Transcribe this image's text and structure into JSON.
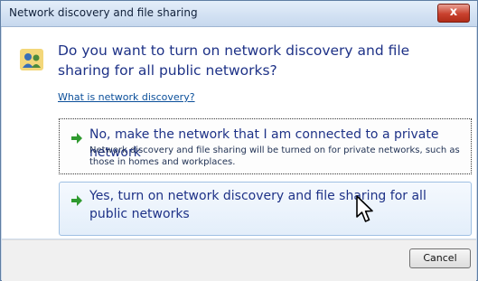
{
  "window": {
    "title": "Network discovery and file sharing",
    "close_label": "x"
  },
  "question": "Do you want to turn on network discovery and file sharing for all public networks?",
  "help_link": "What is network discovery?",
  "options": [
    {
      "title": "No, make the network that I am connected to a private network",
      "description": "Network discovery and file sharing will be turned on for private networks, such as those in homes and workplaces."
    },
    {
      "title": "Yes, turn on network discovery and file sharing for all public networks"
    }
  ],
  "footer": {
    "cancel_label": "Cancel"
  },
  "colors": {
    "accent_text": "#1e3287",
    "arrow_green": "#2f9a2f",
    "link": "#0b4f9a",
    "close_red": "#c9412e"
  },
  "icons": [
    "network-users-icon",
    "arrow-right-icon",
    "mouse-cursor-icon",
    "close-icon"
  ]
}
